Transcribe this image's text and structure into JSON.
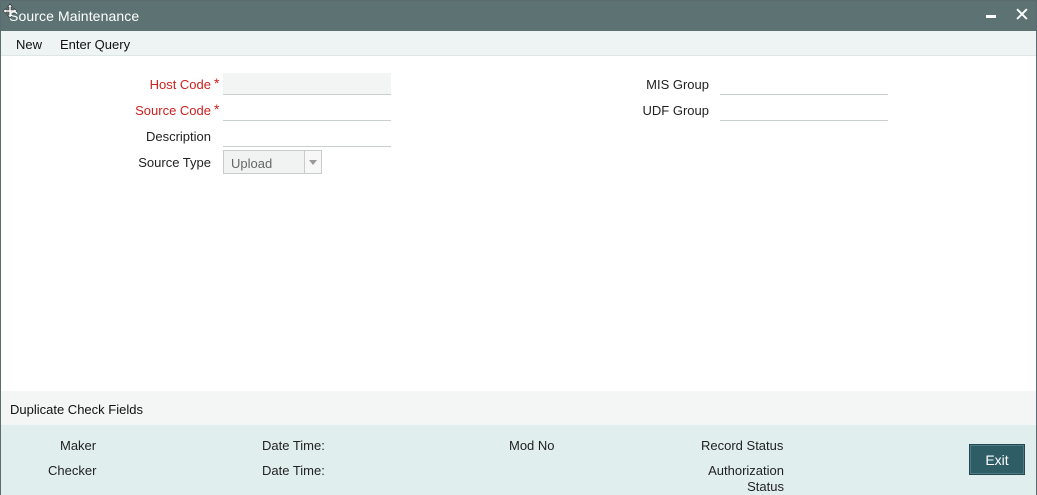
{
  "window": {
    "title": "Source Maintenance",
    "minimize_label": "",
    "close_glyph": "✕"
  },
  "menu": {
    "items": [
      {
        "label": "New"
      },
      {
        "label": "Enter Query"
      }
    ]
  },
  "form": {
    "host_code": {
      "label": "Host Code",
      "required": true,
      "value": ""
    },
    "source_code": {
      "label": "Source Code",
      "required": true,
      "value": ""
    },
    "description": {
      "label": "Description",
      "value": ""
    },
    "source_type": {
      "label": "Source Type",
      "selected": "Upload",
      "options": [
        "Upload"
      ]
    },
    "mis_group": {
      "label": "MIS Group",
      "value": ""
    },
    "udf_group": {
      "label": "UDF Group",
      "value": ""
    },
    "required_marker": "*"
  },
  "duplicate_check": {
    "label": "Duplicate Check Fields"
  },
  "footer": {
    "maker": "Maker",
    "maker_date_time": "Date Time:",
    "mod_no": "Mod No",
    "record_status": "Record Status",
    "checker": "Checker",
    "checker_date_time": "Date Time:",
    "authorization_status_line1": "Authorization",
    "authorization_status_line2": "Status",
    "exit_label": "Exit"
  },
  "colors": {
    "titlebar": "#5c7273",
    "required_label": "#cc1f1f",
    "footer_bg": "#e1eeee",
    "exit_button": "#2f5d66"
  }
}
